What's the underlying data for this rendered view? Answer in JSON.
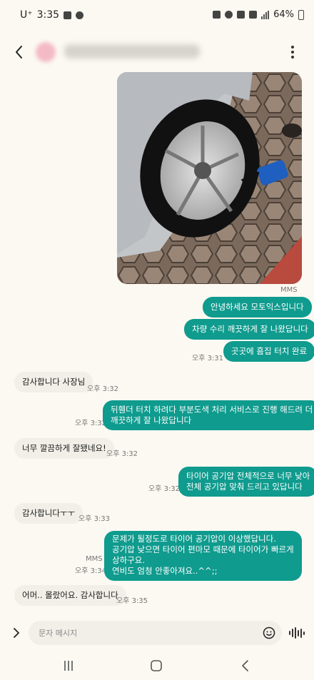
{
  "status_bar": {
    "carrier": "U⁺",
    "time": "3:35",
    "battery": "64%"
  },
  "header": {
    "back_icon": "chevron-left-icon",
    "more_icon": "more-vertical-icon"
  },
  "photo": {
    "icon": "car-tire-photo",
    "label": "MMS"
  },
  "messages": [
    {
      "direction": "out",
      "text": "안녕하세요 모토익스입니다"
    },
    {
      "direction": "out",
      "text": "차량 수리 깨끗하게 잘 나왔답니다"
    },
    {
      "direction": "out",
      "text": "곳곳에 흠집 터치 완료",
      "time": "오후 3:31"
    },
    {
      "direction": "in",
      "text": "감사합니다 사장님",
      "time": "오후 3:32"
    },
    {
      "direction": "out",
      "lines": [
        "뒤휀더 터치 하려다 부분도색 처리 서비스로 진행 해드려 더",
        "깨끗하게 잘 나왔답니다"
      ],
      "time": "오후 3:32"
    },
    {
      "direction": "in",
      "text": "너무 깔끔하게 잘됐네요!",
      "time": "오후 3:32"
    },
    {
      "direction": "out",
      "lines": [
        "타이어 공기압 전체적으로 너무 낮아",
        "전체 공기압 맞춰 드리고 있답니다"
      ],
      "time": "오후 3:32"
    },
    {
      "direction": "in",
      "text": "감사합니다ㅜㅜ",
      "time": "오후 3:33"
    },
    {
      "direction": "out",
      "lines": [
        "문제가 될정도로 타이어 공기압이 이상했답니다.",
        "공기압 낮으면 타이어 편마모 때문에 타이어가 빠르게",
        "상하구요.",
        "연비도 엄청 안좋아져요..^^;;"
      ],
      "time": "오후 3:34",
      "label": "MMS"
    },
    {
      "direction": "in",
      "text": "어머.. 몰랐어요. 감사합니다",
      "time": "오후 3:35"
    }
  ],
  "composer": {
    "placeholder": "문자 메시지",
    "expand_icon": "chevron-right-icon",
    "emoji_icon": "smiley-icon",
    "voice_icon": "voice-waveform-icon"
  },
  "colors": {
    "outgoing_bubble": "#0f9b8e",
    "incoming_bubble": "#f1efe8",
    "background": "#fbf9f2"
  }
}
